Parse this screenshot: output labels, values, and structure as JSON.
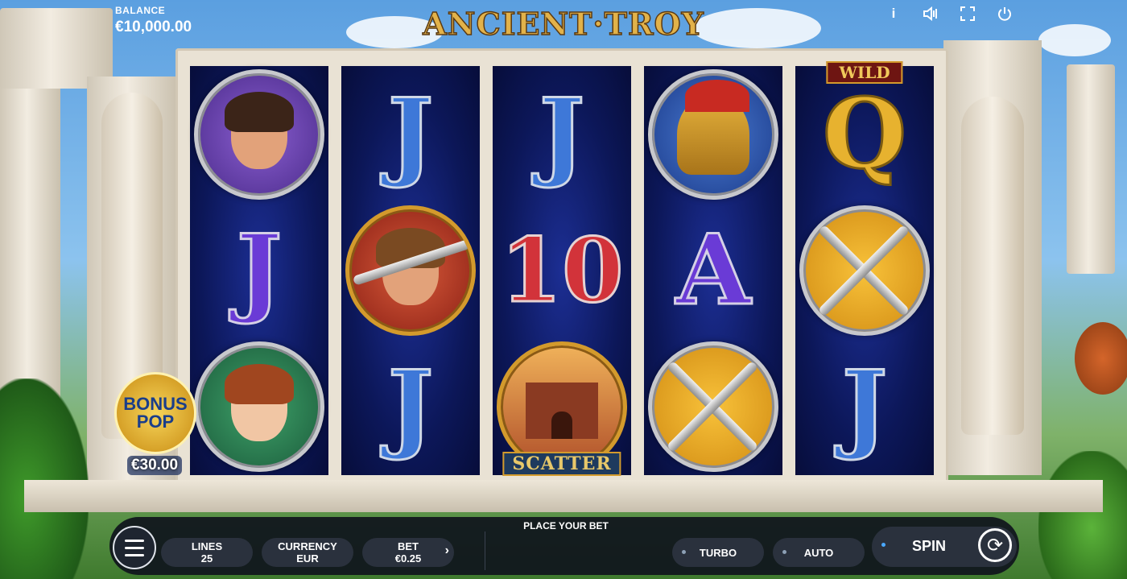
{
  "header": {
    "balance_label": "BALANCE",
    "balance_value": "€10,000.00",
    "logo_text": "ANCIENT·TROY",
    "icons": [
      "info-icon",
      "sound-icon",
      "fullscreen-icon",
      "power-icon"
    ]
  },
  "reels": [
    [
      "hero-bearded-man",
      "J",
      "heroine-woman"
    ],
    [
      "J",
      "warrior-with-sword",
      "J"
    ],
    [
      "J",
      "10",
      "scatter-city-gate"
    ],
    [
      "spartan-helmet",
      "A",
      "crossed-swords-shield"
    ],
    [
      "Q",
      "crossed-swords-shield",
      "J"
    ]
  ],
  "reel_labels": {
    "wild": "WILD",
    "scatter": "SCATTER"
  },
  "bonus": {
    "line1": "BONUS",
    "line2": "POP",
    "amount": "€30.00"
  },
  "controls": {
    "place_bet": "PLACE YOUR BET",
    "lines_label": "LINES",
    "lines_value": "25",
    "currency_label": "CURRENCY",
    "currency_value": "EUR",
    "bet_label": "BET",
    "bet_value": "€0.25",
    "bet_arrow": "›",
    "turbo": "TURBO",
    "auto": "AUTO",
    "spin": "SPIN"
  }
}
